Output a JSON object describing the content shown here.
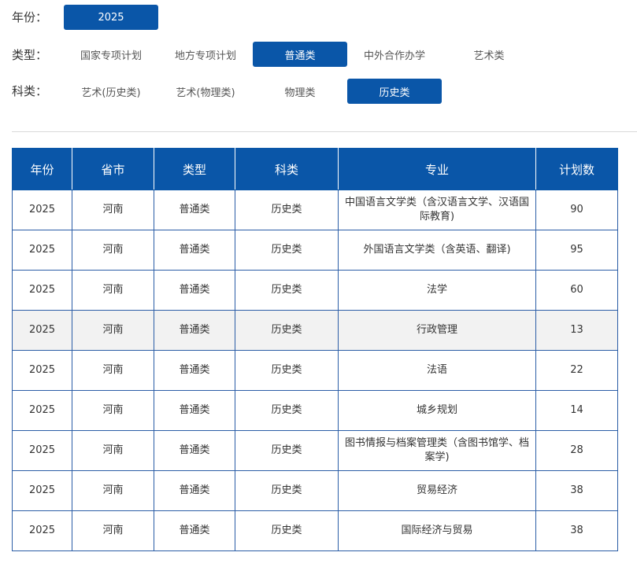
{
  "filters": {
    "year": {
      "label": "年份：",
      "options": [
        {
          "text": "2025",
          "active": true
        }
      ]
    },
    "type": {
      "label": "类型：",
      "options": [
        {
          "text": "国家专项计划",
          "active": false
        },
        {
          "text": "地方专项计划",
          "active": false
        },
        {
          "text": "普通类",
          "active": true
        },
        {
          "text": "中外合作办学",
          "active": false
        },
        {
          "text": "艺术类",
          "active": false
        }
      ]
    },
    "subject": {
      "label": "科类：",
      "options": [
        {
          "text": "艺术(历史类)",
          "active": false
        },
        {
          "text": "艺术(物理类)",
          "active": false
        },
        {
          "text": "物理类",
          "active": false
        },
        {
          "text": "历史类",
          "active": true
        }
      ]
    }
  },
  "table": {
    "headers": [
      "年份",
      "省市",
      "类型",
      "科类",
      "专业",
      "计划数"
    ],
    "rows": [
      [
        "2025",
        "河南",
        "普通类",
        "历史类",
        "中国语言文学类（含汉语言文学、汉语国际教育)",
        "90"
      ],
      [
        "2025",
        "河南",
        "普通类",
        "历史类",
        "外国语言文学类（含英语、翻译)",
        "95"
      ],
      [
        "2025",
        "河南",
        "普通类",
        "历史类",
        "法学",
        "60"
      ],
      [
        "2025",
        "河南",
        "普通类",
        "历史类",
        "行政管理",
        "13"
      ],
      [
        "2025",
        "河南",
        "普通类",
        "历史类",
        "法语",
        "22"
      ],
      [
        "2025",
        "河南",
        "普通类",
        "历史类",
        "城乡规划",
        "14"
      ],
      [
        "2025",
        "河南",
        "普通类",
        "历史类",
        "图书情报与档案管理类（含图书馆学、档案学)",
        "28"
      ],
      [
        "2025",
        "河南",
        "普通类",
        "历史类",
        "贸易经济",
        "38"
      ],
      [
        "2025",
        "河南",
        "普通类",
        "历史类",
        "国际经济与贸易",
        "38"
      ]
    ]
  },
  "colors": {
    "accent": "#0a56a8",
    "row_highlight": "#f2f2f2",
    "border": "#2b5da6"
  }
}
